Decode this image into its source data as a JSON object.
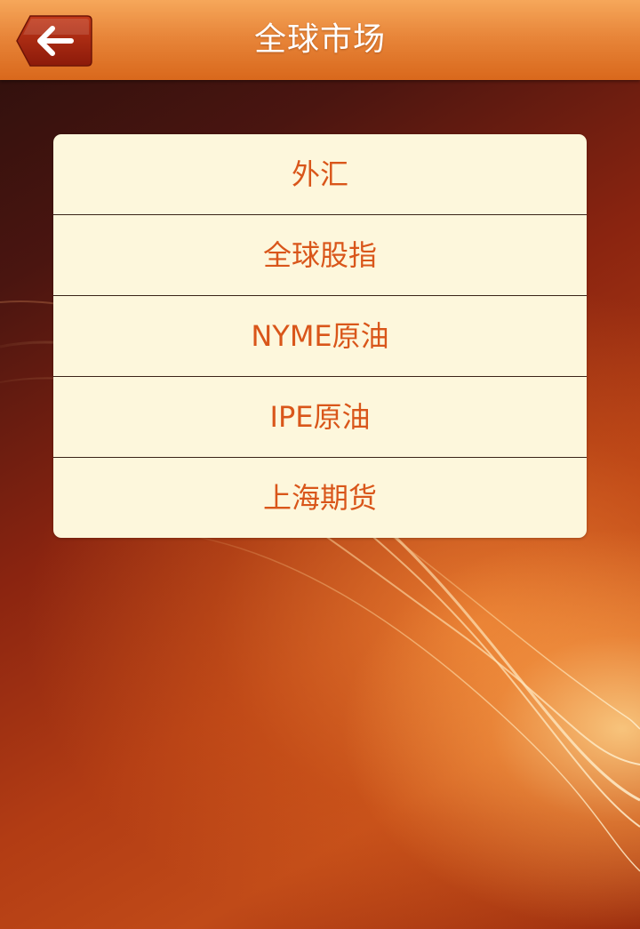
{
  "header": {
    "title": "全球市场",
    "back_icon": "arrow-left-icon"
  },
  "menu": {
    "items": [
      {
        "label": "外汇"
      },
      {
        "label": "全球股指"
      },
      {
        "label": "NYME原油"
      },
      {
        "label": "IPE原油"
      },
      {
        "label": "上海期货"
      }
    ]
  },
  "colors": {
    "header_accent": "#e8863a",
    "menu_background": "#fdf7dc",
    "menu_text": "#d9561a"
  }
}
